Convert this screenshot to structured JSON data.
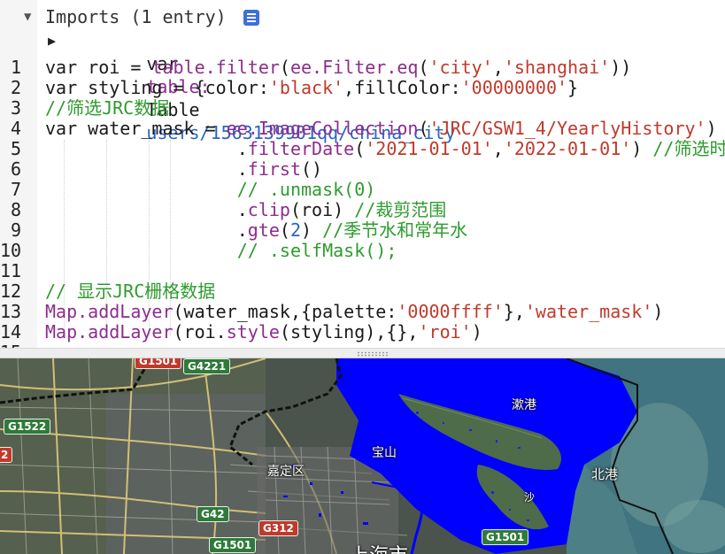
{
  "imports": {
    "label": "Imports (1 entry)",
    "var_keyword": "var",
    "var_name": "table:",
    "var_type": "Table",
    "var_path": "users/1563139901qq/china_city",
    "icon": "list-icon",
    "chevron": "chevron-down-icon",
    "arrow": "triangle-right-icon"
  },
  "code_lines": [
    {
      "n": "1",
      "tokens": [
        {
          "c": "kw",
          "t": "var roi = "
        },
        {
          "c": "pu",
          "t": "table.filter"
        },
        {
          "c": "pl",
          "t": "("
        },
        {
          "c": "pu",
          "t": "ee.Filter.eq"
        },
        {
          "c": "pl",
          "t": "("
        },
        {
          "c": "st",
          "t": "'city'"
        },
        {
          "c": "pl",
          "t": ","
        },
        {
          "c": "st",
          "t": "'shanghai'"
        },
        {
          "c": "pl",
          "t": "))"
        }
      ]
    },
    {
      "n": "2",
      "tokens": [
        {
          "c": "kw",
          "t": "var styling = {color:"
        },
        {
          "c": "st",
          "t": "'black'"
        },
        {
          "c": "pl",
          "t": ",fillColor:"
        },
        {
          "c": "st",
          "t": "'00000000'"
        },
        {
          "c": "pl",
          "t": "}"
        }
      ]
    },
    {
      "n": "3",
      "tokens": [
        {
          "c": "cm",
          "t": "//筛选JRC数据"
        }
      ]
    },
    {
      "n": "4",
      "tokens": [
        {
          "c": "kw",
          "t": "var water_mask = "
        },
        {
          "c": "pu",
          "t": "ee.ImageCollection"
        },
        {
          "c": "pl",
          "t": "("
        },
        {
          "c": "st",
          "t": "'JRC/GSW1_4/YearlyHistory'"
        },
        {
          "c": "pl",
          "t": ")"
        }
      ]
    },
    {
      "n": "5",
      "tokens": [
        {
          "c": "pl",
          "t": "                  ."
        },
        {
          "c": "pu",
          "t": "filterDate"
        },
        {
          "c": "pl",
          "t": "("
        },
        {
          "c": "st",
          "t": "'2021-01-01'"
        },
        {
          "c": "pl",
          "t": ","
        },
        {
          "c": "st",
          "t": "'2022-01-01'"
        },
        {
          "c": "pl",
          "t": ") "
        },
        {
          "c": "cm",
          "t": "//筛选时间"
        }
      ]
    },
    {
      "n": "6",
      "tokens": [
        {
          "c": "pl",
          "t": "                  ."
        },
        {
          "c": "pu",
          "t": "first"
        },
        {
          "c": "pl",
          "t": "()"
        }
      ]
    },
    {
      "n": "7",
      "tokens": [
        {
          "c": "cm",
          "t": "                  // .unmask(0)"
        }
      ]
    },
    {
      "n": "8",
      "tokens": [
        {
          "c": "pl",
          "t": "                  ."
        },
        {
          "c": "pu",
          "t": "clip"
        },
        {
          "c": "pl",
          "t": "(roi) "
        },
        {
          "c": "cm",
          "t": "//裁剪范围"
        }
      ]
    },
    {
      "n": "9",
      "tokens": [
        {
          "c": "pl",
          "t": "                  ."
        },
        {
          "c": "pu",
          "t": "gte"
        },
        {
          "c": "pl",
          "t": "("
        },
        {
          "c": "nu",
          "t": "2"
        },
        {
          "c": "pl",
          "t": ") "
        },
        {
          "c": "cm",
          "t": "//季节水和常年水"
        }
      ]
    },
    {
      "n": "10",
      "tokens": [
        {
          "c": "cm",
          "t": "                  // .selfMask();"
        }
      ]
    },
    {
      "n": "11",
      "tokens": []
    },
    {
      "n": "12",
      "tokens": [
        {
          "c": "cm",
          "t": "// 显示JRC栅格数据"
        }
      ]
    },
    {
      "n": "13",
      "tokens": [
        {
          "c": "pu",
          "t": "Map.addLayer"
        },
        {
          "c": "pl",
          "t": "(water_mask,{palette:"
        },
        {
          "c": "st",
          "t": "'0000ffff'"
        },
        {
          "c": "pl",
          "t": "},"
        },
        {
          "c": "st",
          "t": "'water_mask'"
        },
        {
          "c": "pl",
          "t": ")"
        }
      ]
    },
    {
      "n": "14",
      "tokens": [
        {
          "c": "pu",
          "t": "Map.addLayer"
        },
        {
          "c": "pl",
          "t": "(roi."
        },
        {
          "c": "pu",
          "t": "style"
        },
        {
          "c": "pl",
          "t": "(styling),{},"
        },
        {
          "c": "st",
          "t": "'roi'"
        },
        {
          "c": "pl",
          "t": ")"
        }
      ]
    },
    {
      "n": "15",
      "tokens": []
    }
  ],
  "colors": {
    "string": "#c0392b",
    "comment": "#2e9b2e",
    "method": "#8d2c8e",
    "number": "#2a64c6",
    "water": "#0000ff"
  },
  "map": {
    "labels": {
      "jiading": "嘉定区",
      "baoshan": "宝山",
      "beigang": "北港",
      "chongming_hint": "崇",
      "liuhe": "沙",
      "shanghai": "上海市",
      "haigang": "漱港"
    },
    "shields": {
      "g4221": "G4221",
      "g1522": "G1522",
      "g2": "2",
      "g42": "G42",
      "g312": "G312",
      "g1501_left": "G1501",
      "g1501_right": "G1501",
      "top_red": "G1501"
    }
  }
}
